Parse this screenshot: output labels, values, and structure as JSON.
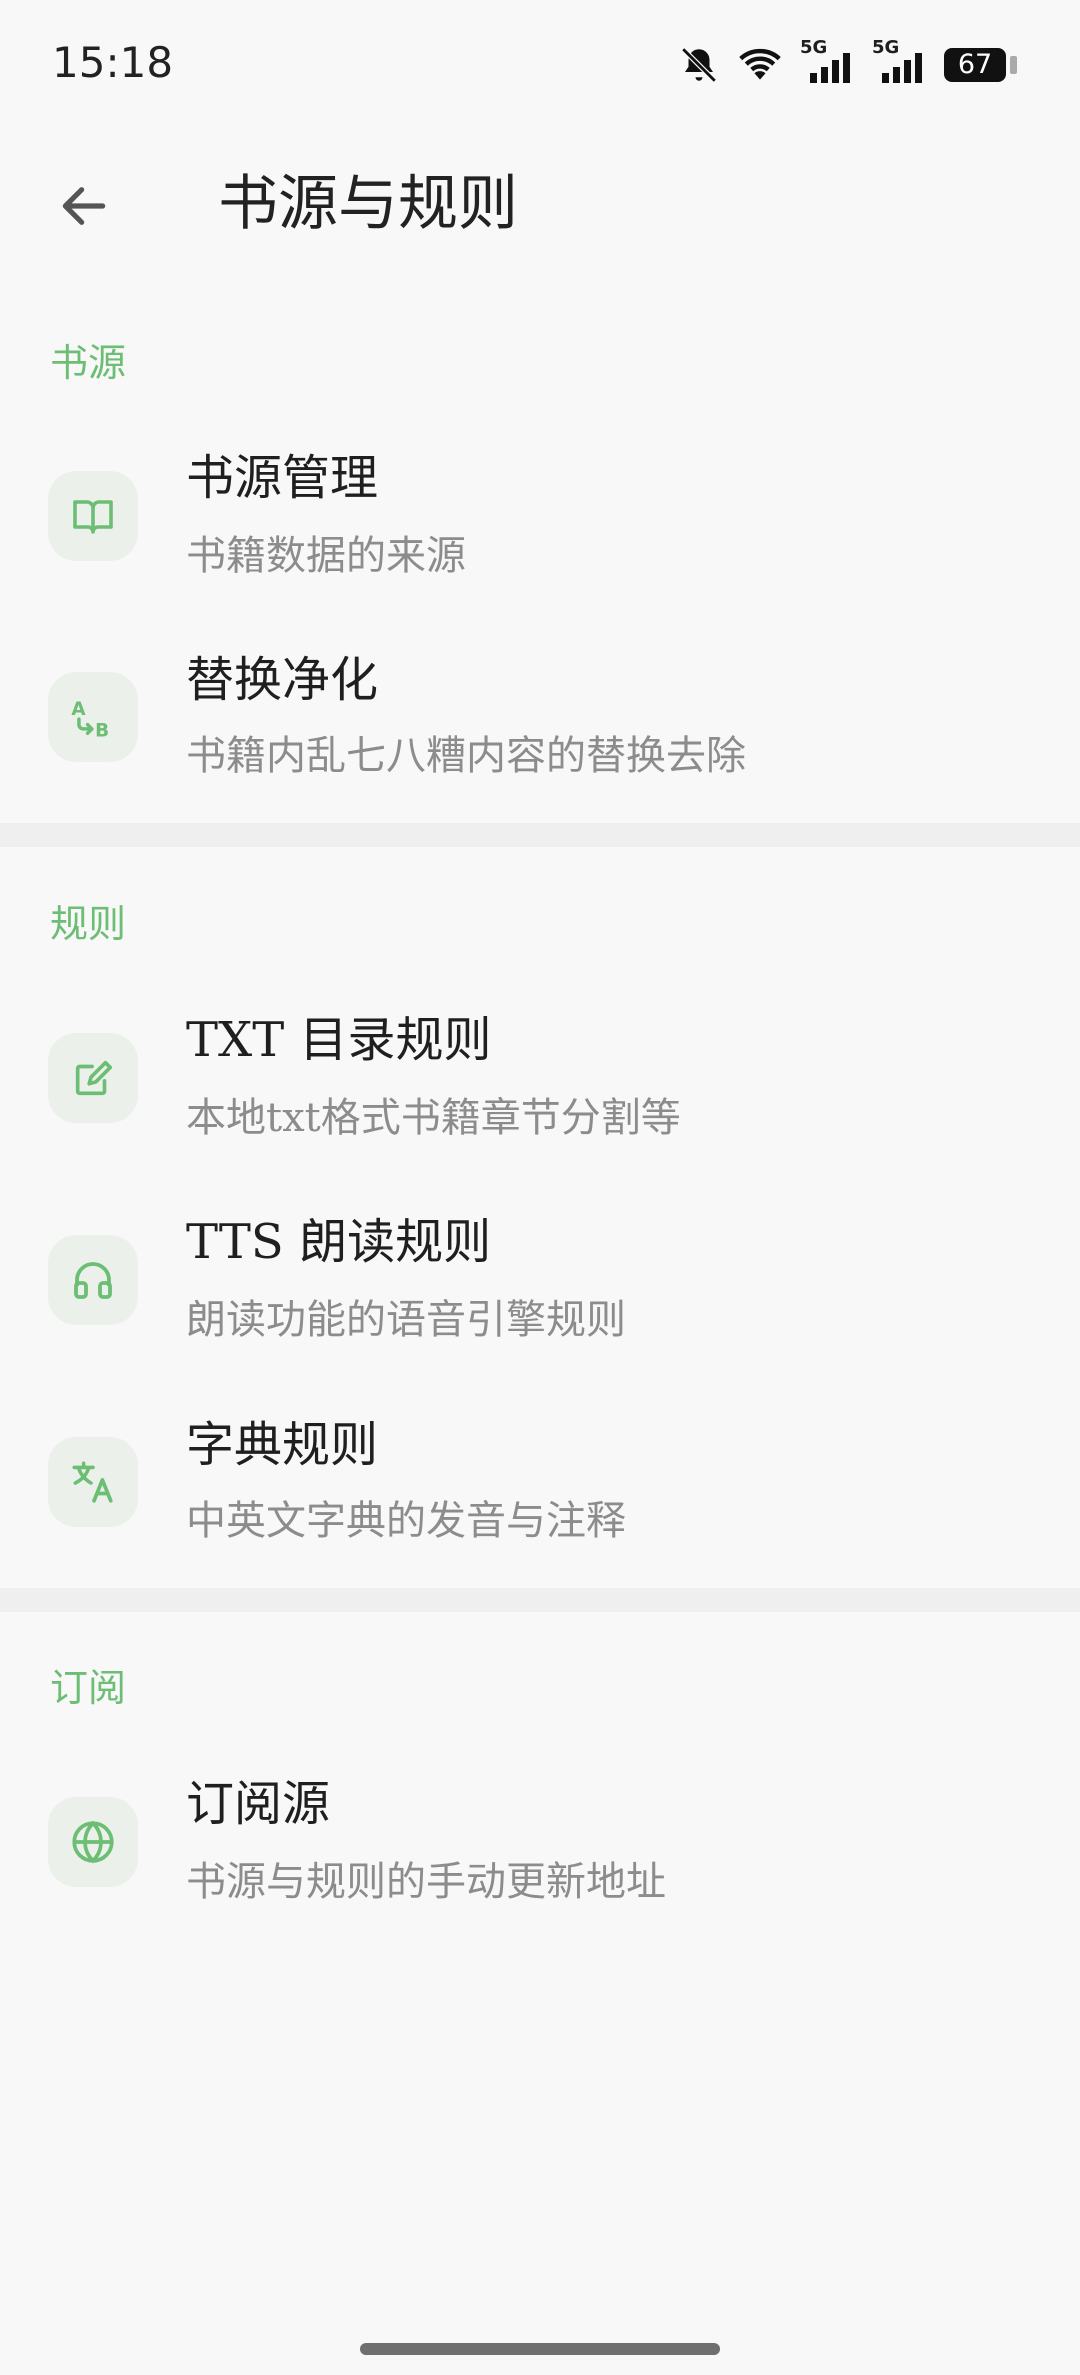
{
  "status_bar": {
    "time": "15:18",
    "battery": "67",
    "network_1": "5G",
    "network_2": "5G",
    "icons": [
      "mute-bell-icon",
      "wifi-icon",
      "signal-5g-icon",
      "signal-5g-icon",
      "battery-icon"
    ]
  },
  "app_bar": {
    "title": "书源与规则",
    "back_icon": "back-arrow-icon"
  },
  "colors": {
    "accent": "#6cbe74",
    "icon_bg": "#ebf1ea",
    "background": "#f8f8f8",
    "divider": "#efefef"
  },
  "sections": [
    {
      "title": "书源",
      "items": [
        {
          "title": "书源管理",
          "subtitle": "书籍数据的来源",
          "icon": "book-open-icon"
        },
        {
          "title": "替换净化",
          "subtitle": "书籍内乱七八糟内容的替换去除",
          "icon": "replace-ab-icon"
        }
      ]
    },
    {
      "title": "规则",
      "items": [
        {
          "title": "TXT 目录规则",
          "subtitle": "本地txt格式书籍章节分割等",
          "icon": "edit-note-icon"
        },
        {
          "title": "TTS 朗读规则",
          "subtitle": "朗读功能的语音引擎规则",
          "icon": "headphones-icon"
        },
        {
          "title": "字典规则",
          "subtitle": "中英文字典的发音与注释",
          "icon": "translate-icon"
        }
      ]
    },
    {
      "title": "订阅",
      "items": [
        {
          "title": "订阅源",
          "subtitle": "书源与规则的手动更新地址",
          "icon": "globe-icon"
        }
      ]
    }
  ]
}
